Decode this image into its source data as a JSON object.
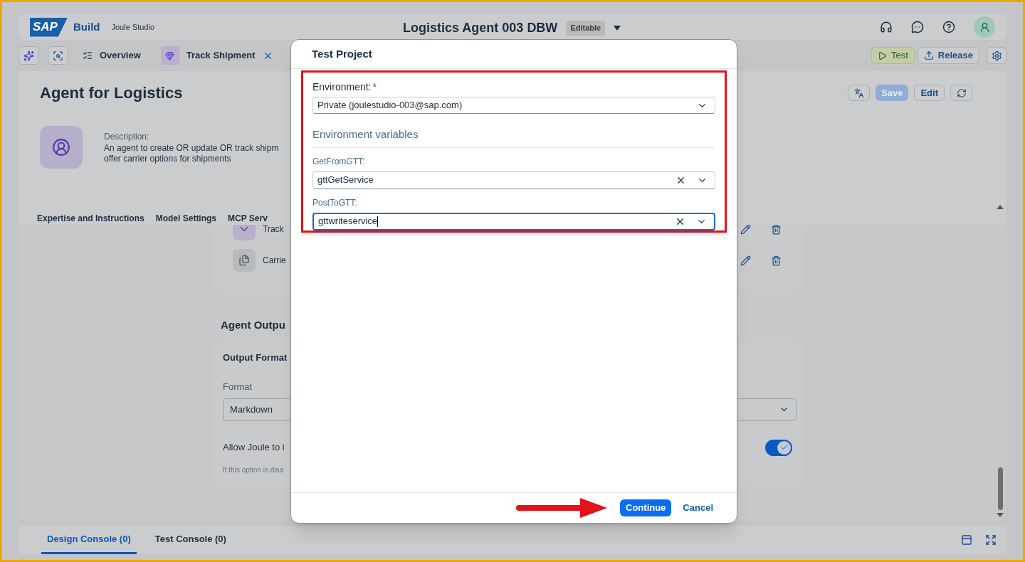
{
  "shell": {
    "logo": "SAP",
    "product": "Build",
    "app": "Joule Studio",
    "title": "Logistics Agent 003 DBW",
    "badge": "Editable"
  },
  "tabs": [
    {
      "label": "Overview",
      "kind": "page",
      "closable": false
    },
    {
      "label": "Track Shipment",
      "kind": "tool",
      "closable": true
    }
  ],
  "actions": [
    {
      "label": "Test",
      "kind": "test"
    },
    {
      "label": "Release",
      "kind": "release"
    }
  ],
  "agent": {
    "title": "Agent for Logistics",
    "description_label": "Description:",
    "description": [
      "An agent to create OR update OR track shipm",
      "offer carrier options for shipments"
    ],
    "buttons": [
      {
        "label": "Save",
        "disabled": true
      },
      {
        "label": "Edit",
        "disabled": false
      }
    ]
  },
  "sections": [
    "Expertise and Instructions",
    "Model Settings",
    "MCP Serv"
  ],
  "tools": [
    {
      "name": "Track",
      "kind": "tool"
    },
    {
      "name": "Carrie",
      "kind": "document"
    }
  ],
  "output": {
    "heading": "Agent Outpu",
    "card_title": "Output Format",
    "format_label": "Format",
    "format_value": "Markdown",
    "toggle_label": "Allow Joule to i",
    "toggle_on": true,
    "hint": "If this option is disa"
  },
  "console_tabs": [
    {
      "label": "Design Console (0)",
      "selected": true
    },
    {
      "label": "Test Console (0)",
      "selected": false
    }
  ],
  "dialog": {
    "title": "Test Project",
    "environment": {
      "label": "Environment:",
      "required_mark": "*",
      "value": "Private (joulestudio-003@sap.com)"
    },
    "variables_heading": "Environment variables",
    "variables": [
      {
        "label": "GetFromGTT:",
        "value": "gttGetService",
        "focused": false
      },
      {
        "label": "PostToGTT:",
        "value": "gttwriteservice",
        "focused": true
      }
    ],
    "buttons": [
      {
        "label": "Continue",
        "kind": "primary"
      },
      {
        "label": "Cancel",
        "kind": "transparent"
      }
    ]
  }
}
